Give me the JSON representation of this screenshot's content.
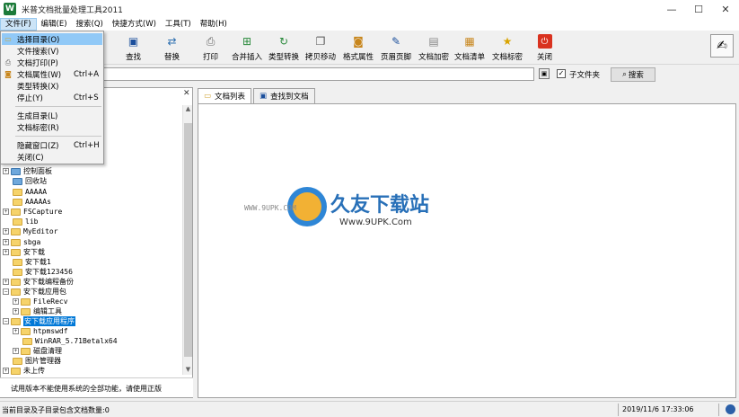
{
  "window": {
    "title": "米普文档批量处理工具2011",
    "icon_letter": "W",
    "minimize": "—",
    "maximize": "☐",
    "close": "✕"
  },
  "menubar": {
    "items": [
      {
        "label": "文件(F)"
      },
      {
        "label": "编辑(E)"
      },
      {
        "label": "搜索(Q)"
      },
      {
        "label": "快捷方式(W)"
      },
      {
        "label": "工具(T)"
      },
      {
        "label": "帮助(H)"
      }
    ]
  },
  "toolbar": {
    "buttons": [
      {
        "label": "查找",
        "icon": "binoculars-icon"
      },
      {
        "label": "替换",
        "icon": "replace-icon"
      },
      {
        "label": "打印",
        "icon": "printer-icon"
      },
      {
        "label": "合并插入",
        "icon": "merge-icon"
      },
      {
        "label": "类型转换",
        "icon": "convert-icon"
      },
      {
        "label": "拷贝移动",
        "icon": "copy-move-icon"
      },
      {
        "label": "格式属性",
        "icon": "format-icon"
      },
      {
        "label": "页眉页脚",
        "icon": "header-footer-icon"
      },
      {
        "label": "文档加密",
        "icon": "encrypt-icon"
      },
      {
        "label": "文档清单",
        "icon": "list-icon"
      },
      {
        "label": "文档标密",
        "icon": "star-icon"
      },
      {
        "label": "关闭",
        "icon": "power-icon"
      }
    ]
  },
  "search": {
    "value": "",
    "subfolder_checked": "✓",
    "subfolder_label": "子文件夹",
    "search_button": "搜索"
  },
  "file_menu": {
    "items": [
      {
        "label": "选择目录(O)",
        "shortcut": ""
      },
      {
        "label": "文件搜索(V)",
        "shortcut": ""
      },
      {
        "label": "文档打印(P)",
        "shortcut": ""
      },
      {
        "label": "文档属性(W)",
        "shortcut": "Ctrl+A"
      },
      {
        "label": "类型转换(X)",
        "shortcut": ""
      },
      {
        "label": "停止(Y)",
        "shortcut": "Ctrl+S"
      },
      {
        "label": "生成目录(L)",
        "shortcut": ""
      },
      {
        "label": "文档标密(R)",
        "shortcut": ""
      },
      {
        "label": "隐藏窗口(Z)",
        "shortcut": "Ctrl+H"
      },
      {
        "label": "关闭(C)",
        "shortcut": ""
      }
    ]
  },
  "tree": {
    "items": [
      {
        "label": "控制面板",
        "expander": "+"
      },
      {
        "label": "回收站",
        "expander": ""
      },
      {
        "label": "AAAAA",
        "expander": ""
      },
      {
        "label": "AAAAAs",
        "expander": ""
      },
      {
        "label": "FSCapture",
        "expander": "+"
      },
      {
        "label": "lib",
        "expander": ""
      },
      {
        "label": "MyEditor",
        "expander": "+"
      },
      {
        "label": "sbga",
        "expander": "+"
      },
      {
        "label": "安下载",
        "expander": "+"
      },
      {
        "label": "安下载1",
        "expander": ""
      },
      {
        "label": "安下载123456",
        "expander": ""
      },
      {
        "label": "安下载编程备份",
        "expander": "+"
      },
      {
        "label": "安下载应用包",
        "expander": "−"
      },
      {
        "label": "FileRecv",
        "expander": "+"
      },
      {
        "label": "编辑工具",
        "expander": "+"
      },
      {
        "label": "安下载应用程序",
        "expander": "−"
      },
      {
        "label": "htpmswdf",
        "expander": "+"
      },
      {
        "label": "WinRAR_5.71Betalx64",
        "expander": ""
      },
      {
        "label": "磁盘清理",
        "expander": "+"
      },
      {
        "label": "图片管理器",
        "expander": ""
      },
      {
        "label": "未上传",
        "expander": "+"
      }
    ],
    "trial_note": "试用版本不能使用系统的全部功能，请使用正版"
  },
  "tabs": [
    {
      "label": "文档列表"
    },
    {
      "label": "查找到文档"
    }
  ],
  "watermark": {
    "title": "久友下载站",
    "url": "Www.9UPK.Com",
    "small": "WWW.9UPK.COM"
  },
  "status": {
    "left": "当前目录及子目录包含文档数量:0",
    "time": "2019/11/6 17:33:06"
  }
}
